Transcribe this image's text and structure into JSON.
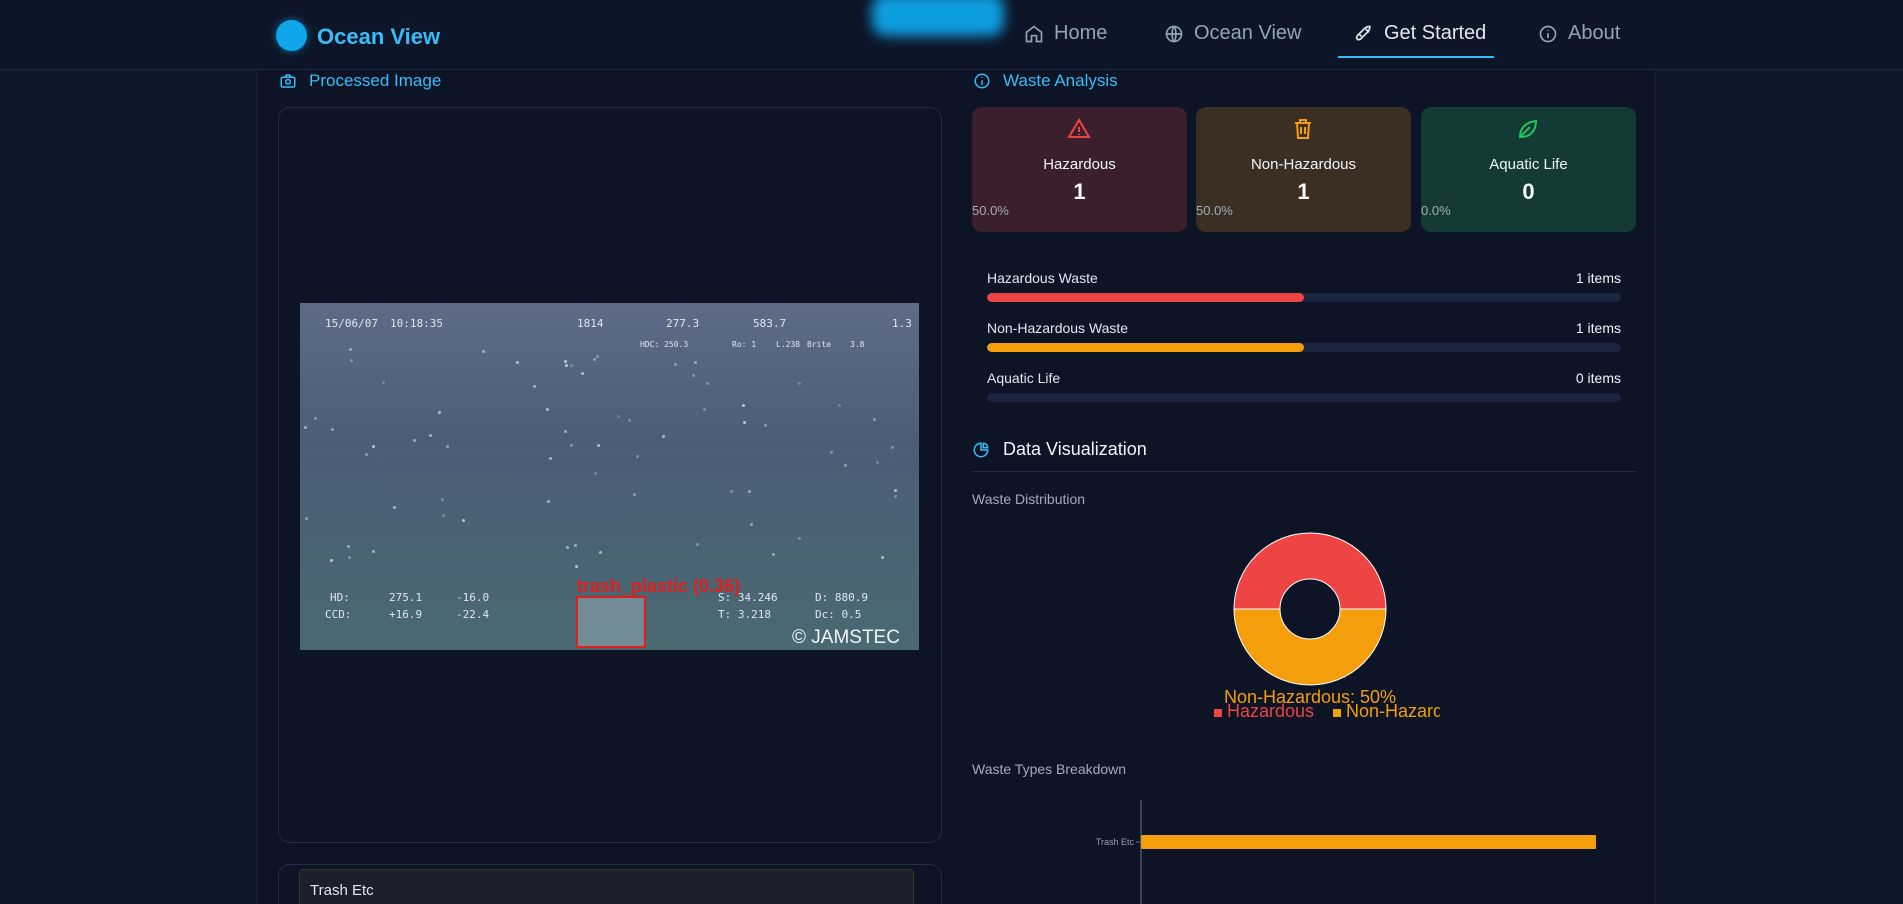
{
  "nav": {
    "logo": "Ocean View",
    "items": [
      {
        "label": "Home",
        "icon": "home-icon"
      },
      {
        "label": "Ocean View",
        "icon": "globe-icon"
      },
      {
        "label": "Get Started",
        "icon": "rocket-icon"
      },
      {
        "label": "About",
        "icon": "info-icon"
      }
    ],
    "active": "Get Started"
  },
  "processed": {
    "title": "Processed Image",
    "icon": "camera-icon",
    "image": {
      "osd_top": [
        "15/06/07",
        "10:18:35",
        "1814",
        "277.3",
        "583.7",
        "1.3"
      ],
      "osd_top_small": [
        "HDC: 250.3",
        "Ro: 1",
        "L.238",
        "Brite",
        "3.8"
      ],
      "osd_left": [
        "HD:",
        "CCD:",
        "275.1",
        "+16.9",
        "-16.0",
        "-22.4"
      ],
      "osd_right": [
        "S: 34.246",
        "T: 3.218",
        "D: 880.9",
        "Dc: 0.5"
      ],
      "detection_label": "trash_plastic (0.36)",
      "watermark": "© JAMSTEC"
    },
    "detections": [
      {
        "label": "Trash Etc"
      }
    ]
  },
  "analysis": {
    "title": "Waste Analysis",
    "icon": "info-icon",
    "cards": [
      {
        "title": "Hazardous",
        "count": "1",
        "percent": "50.0%",
        "icon": "warning-triangle-icon",
        "color": "#ef4444"
      },
      {
        "title": "Non-Hazardous",
        "count": "1",
        "percent": "50.0%",
        "icon": "trash-bin-icon",
        "color": "#f59e0b"
      },
      {
        "title": "Aquatic Life",
        "count": "0",
        "percent": "0.0%",
        "icon": "leaf-icon",
        "color": "#22c55e"
      }
    ],
    "bars": [
      {
        "label": "Hazardous Waste",
        "count": "1 items",
        "fraction": 0.5,
        "color": "#ef4444"
      },
      {
        "label": "Non-Hazardous Waste",
        "count": "1 items",
        "fraction": 0.5,
        "color": "#f59e0b"
      },
      {
        "label": "Aquatic Life",
        "count": "0 items",
        "fraction": 0.0,
        "color": "#22c55e"
      }
    ]
  },
  "visualization": {
    "title": "Data Visualization",
    "icon": "pie-chart-icon",
    "distribution_title": "Waste Distribution",
    "breakdown_title": "Waste Types Breakdown"
  },
  "chart_data": [
    {
      "type": "pie",
      "title": "Waste Distribution",
      "categories": [
        "Hazardous",
        "Non-Hazardous"
      ],
      "values": [
        50,
        50
      ],
      "colors": [
        "#ef4444",
        "#f59e0b"
      ],
      "slice_label": "Non-Hazardous: 50%",
      "legend": "bottom"
    },
    {
      "type": "bar",
      "orientation": "horizontal",
      "title": "Waste Types Breakdown",
      "categories": [
        "Trash Etc"
      ],
      "values": [
        1
      ],
      "color": "#f59e0b"
    }
  ]
}
